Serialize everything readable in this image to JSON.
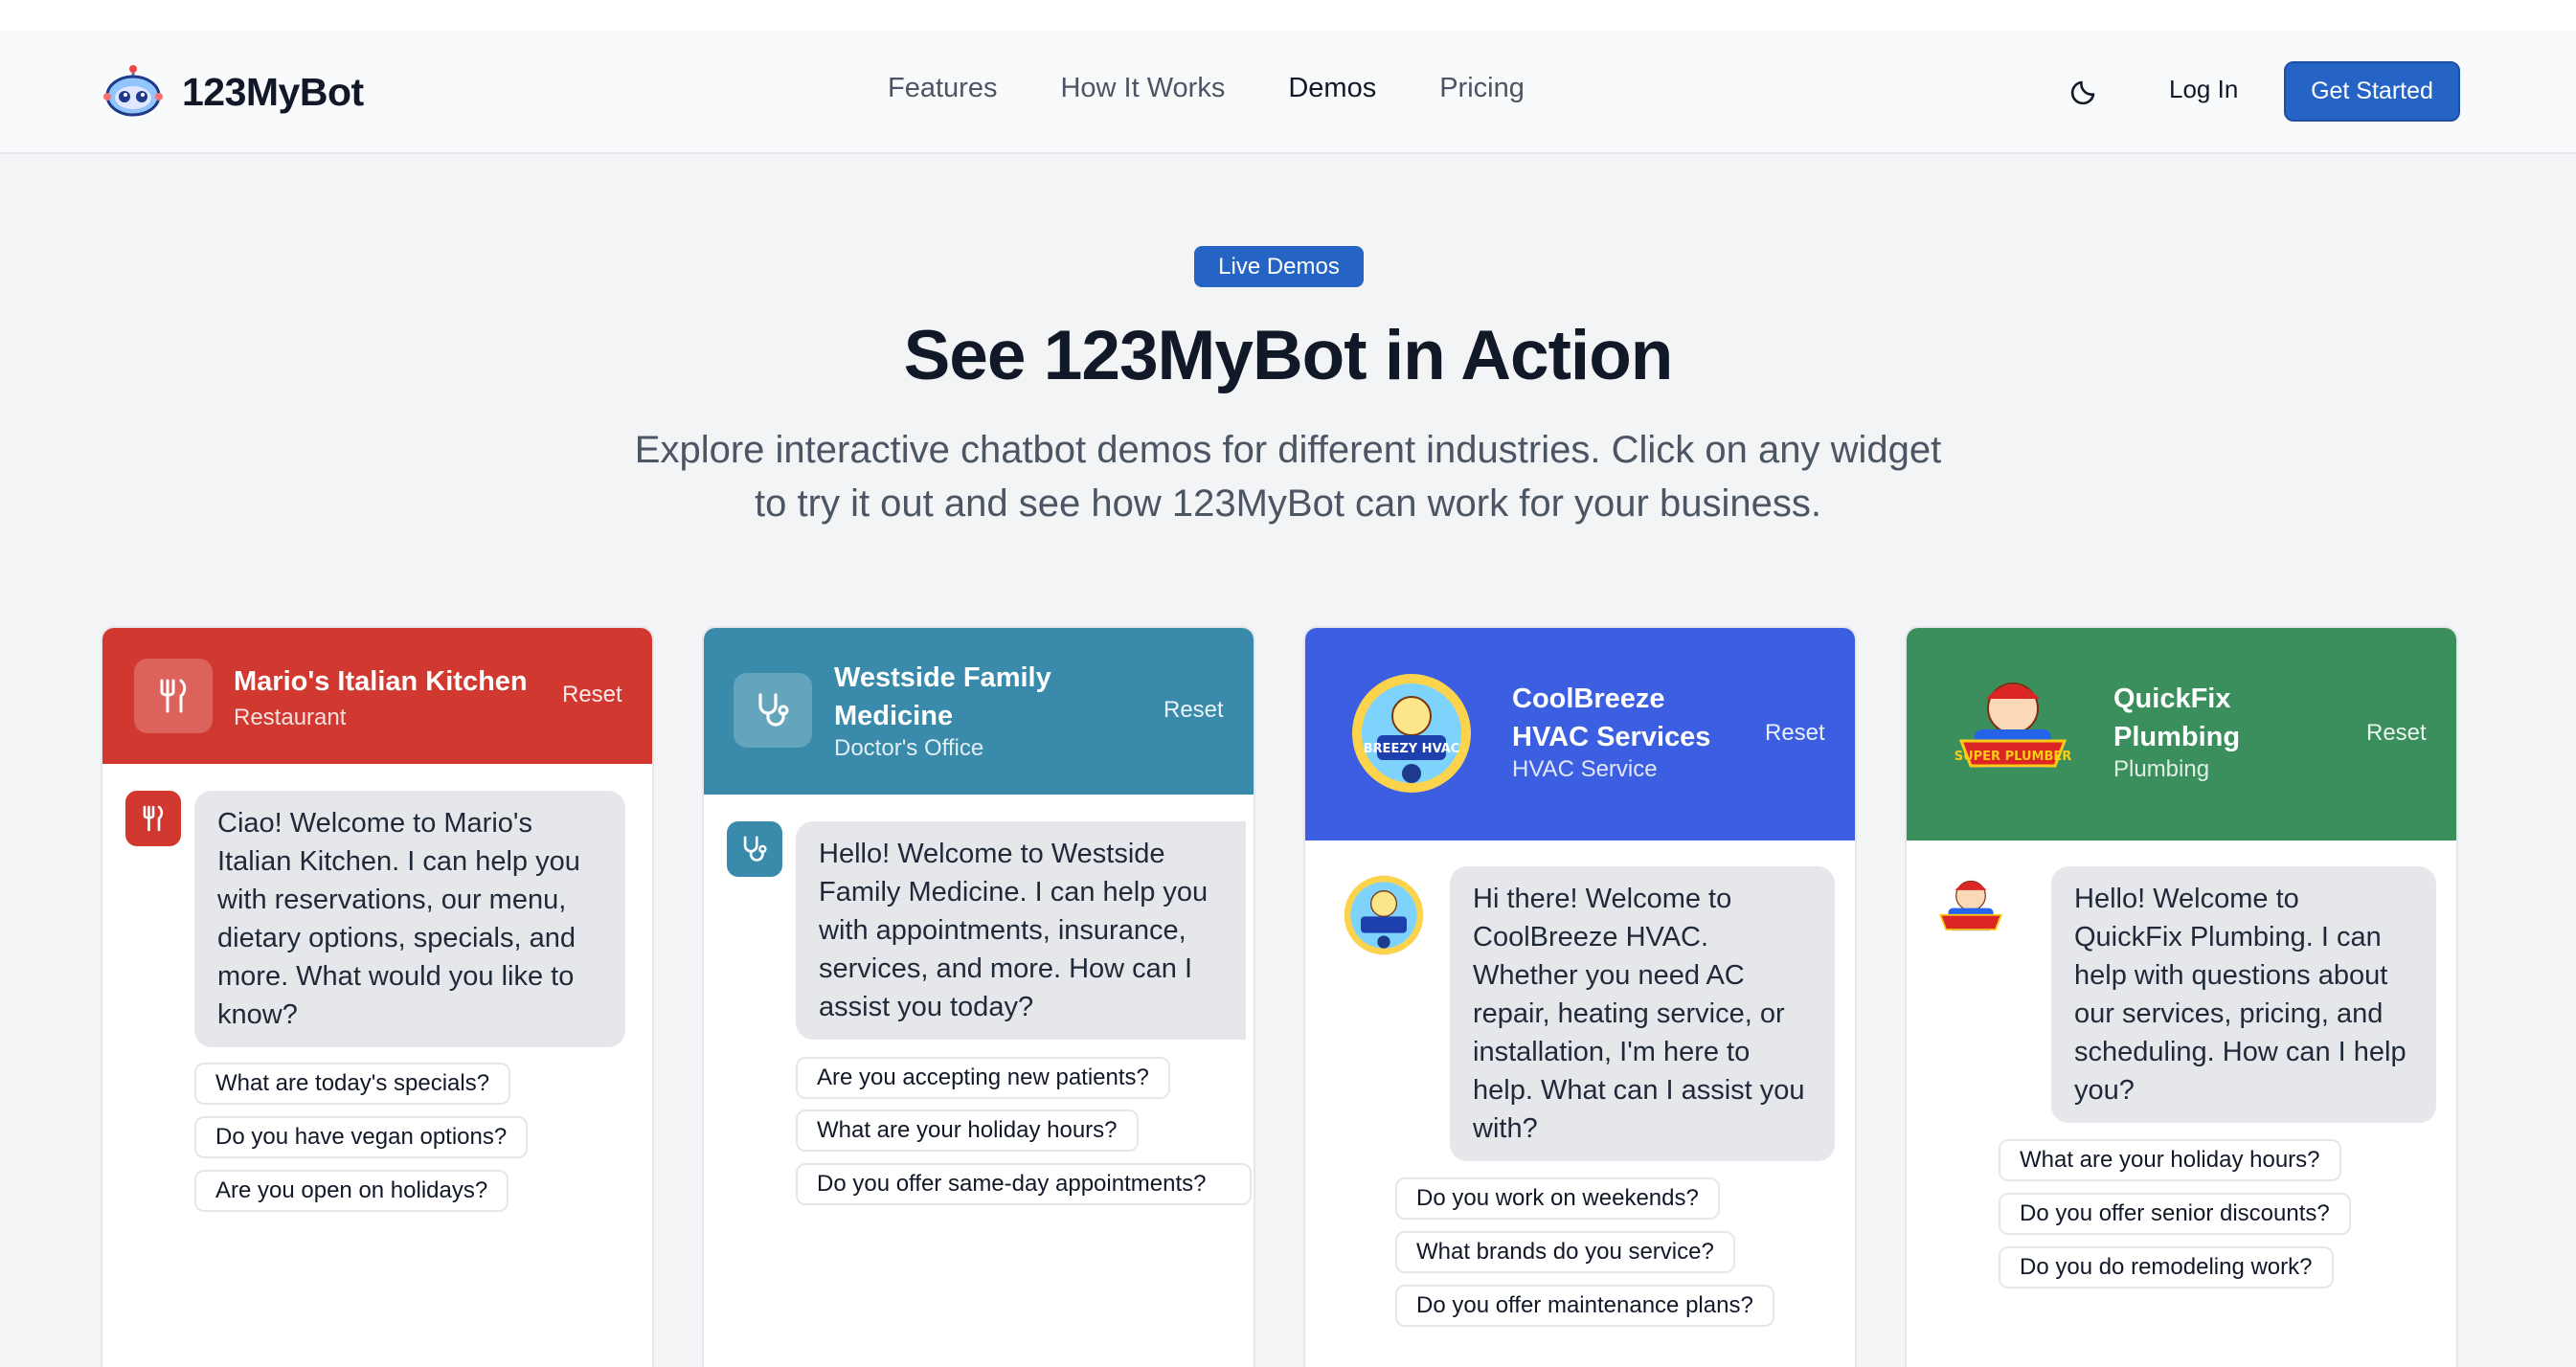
{
  "nav": {
    "brand": "123MyBot",
    "links": [
      "Features",
      "How It Works",
      "Demos",
      "Pricing"
    ],
    "login": "Log In",
    "cta": "Get Started"
  },
  "hero": {
    "badge": "Live Demos",
    "title": "See 123MyBot in Action",
    "subtitle": "Explore interactive chatbot demos for different industries. Click on any widget to try it out and see how 123MyBot can work for your business."
  },
  "cards": [
    {
      "title": "Mario's Italian Kitchen",
      "subtitle": "Restaurant",
      "reset": "Reset",
      "color": "#d1382f",
      "message": "Ciao! Welcome to Mario's Italian Kitchen. I can help you with reservations, our menu, dietary options, specials, and more. What would you like to know?",
      "suggestions": [
        "What are today's specials?",
        "Do you have vegan options?",
        "Are you open on holidays?"
      ]
    },
    {
      "title": "Westside Family Medicine",
      "subtitle": "Doctor's Office",
      "reset": "Reset",
      "color": "#3a8bab",
      "message": "Hello! Welcome to Westside Family Medicine. I can help you with appointments, insurance, services, and more. How can I assist you today?",
      "suggestions": [
        "Are you accepting new patients?",
        "What are your holiday hours?",
        "Do you offer same-day appointments?"
      ]
    },
    {
      "title": "CoolBreeze HVAC Services",
      "subtitle": "HVAC Service",
      "reset": "Reset",
      "color": "#3b5fe0",
      "logo_text": "BREEZY HVAC",
      "message": "Hi there! Welcome to CoolBreeze HVAC. Whether you need AC repair, heating service, or installation, I'm here to help. What can I assist you with?",
      "suggestions": [
        "Do you work on weekends?",
        "What brands do you service?",
        "Do you offer maintenance plans?"
      ]
    },
    {
      "title": "QuickFix Plumbing",
      "subtitle": "Plumbing",
      "reset": "Reset",
      "color": "#3a8f5c",
      "logo_text": "SUPER PLUMBER",
      "message": "Hello! Welcome to QuickFix Plumbing. I can help with questions about our services, pricing, and scheduling. How can I help you?",
      "suggestions": [
        "What are your holiday hours?",
        "Do you offer senior discounts?",
        "Do you do remodeling work?"
      ]
    }
  ]
}
